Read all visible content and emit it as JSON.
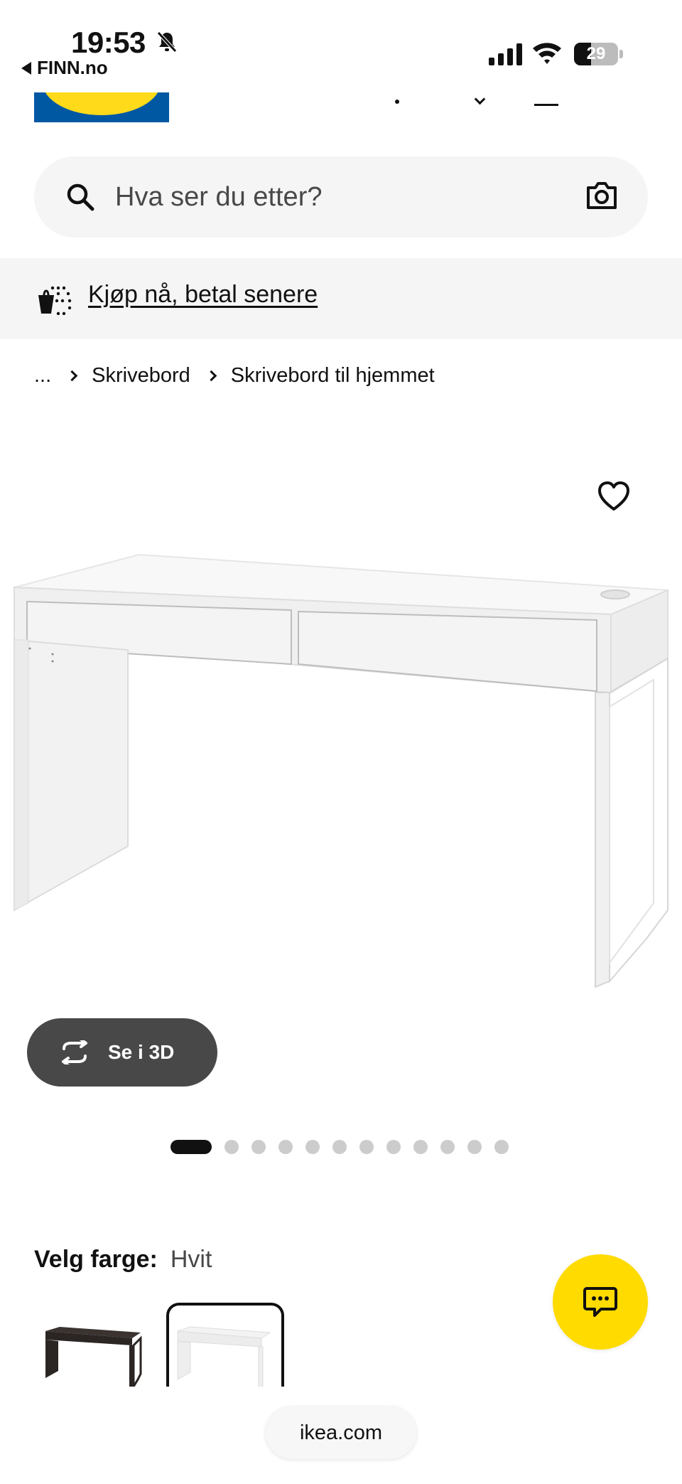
{
  "status_bar": {
    "time": "19:53",
    "back_app": "FINN.no",
    "battery": "29"
  },
  "search": {
    "placeholder": "Hva ser du etter?"
  },
  "bnpl": {
    "label": "Kjøp nå, betal senere"
  },
  "breadcrumb": {
    "ellipsis": "...",
    "items": [
      "Skrivebord",
      "Skrivebord til hjemmet"
    ]
  },
  "gallery": {
    "view_3d_label": "Se i 3D",
    "image_count": 12,
    "active_index": 0
  },
  "color_select": {
    "label": "Velg farge:",
    "value": "Hvit"
  },
  "browser": {
    "url": "ikea.com"
  },
  "colors": {
    "brand_yellow": "#ffdb00",
    "brand_blue": "#0058a3",
    "dark_button": "#484848"
  }
}
